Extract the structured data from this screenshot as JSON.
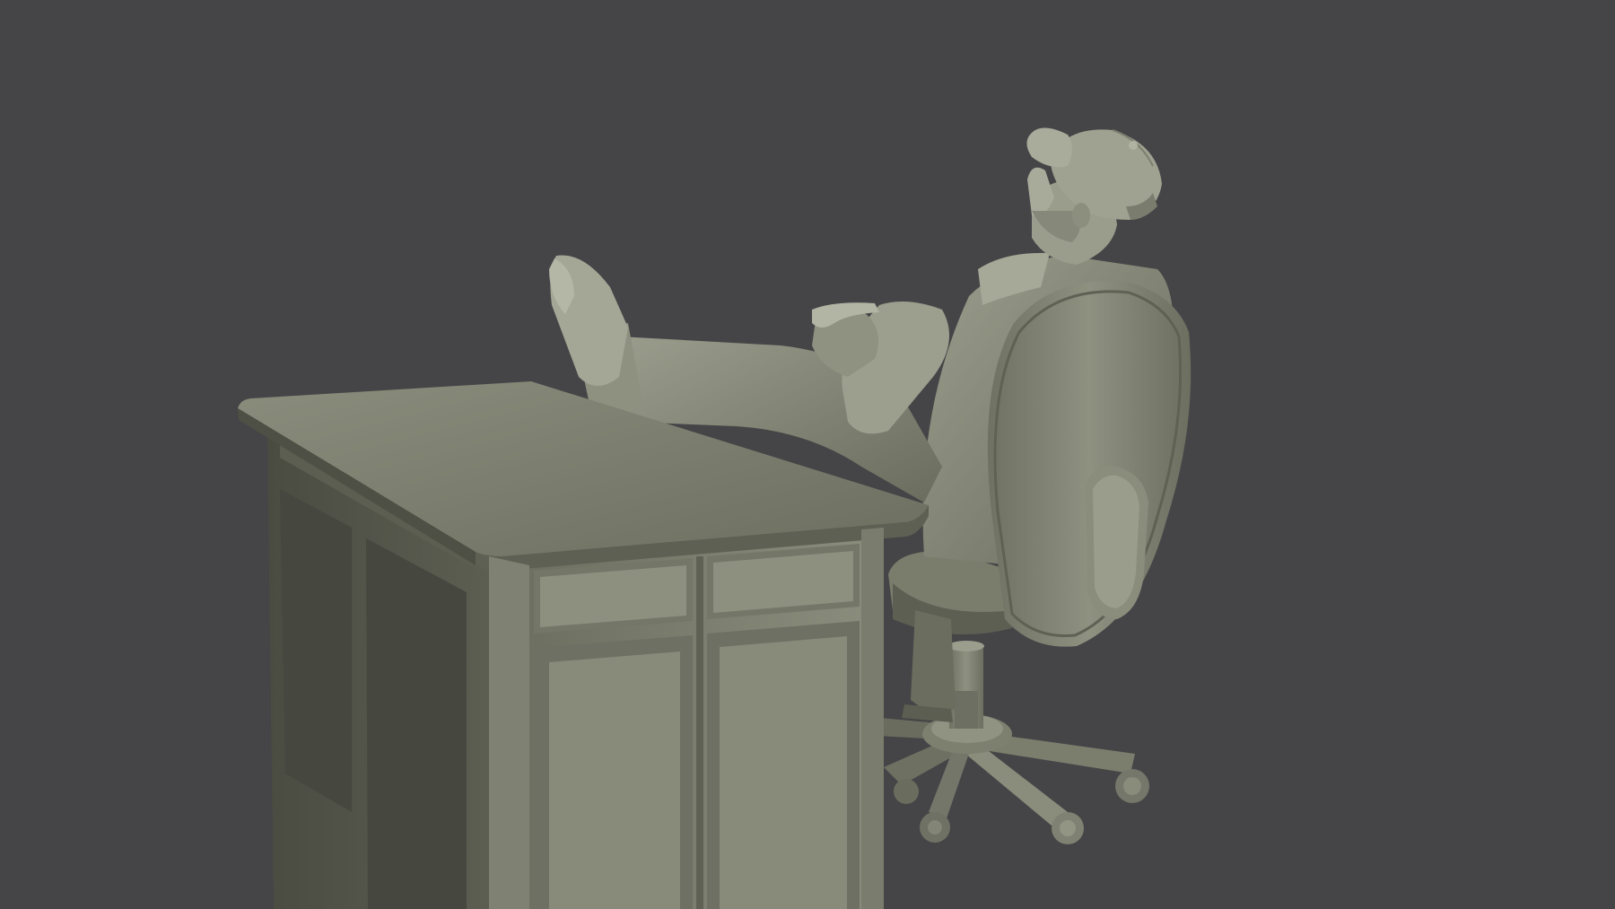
{
  "scene": {
    "background_color": "#454547",
    "model_color": "#7c7e6e",
    "model_shadow_color": "#4e5045",
    "model_highlight_color": "#a3a595"
  }
}
